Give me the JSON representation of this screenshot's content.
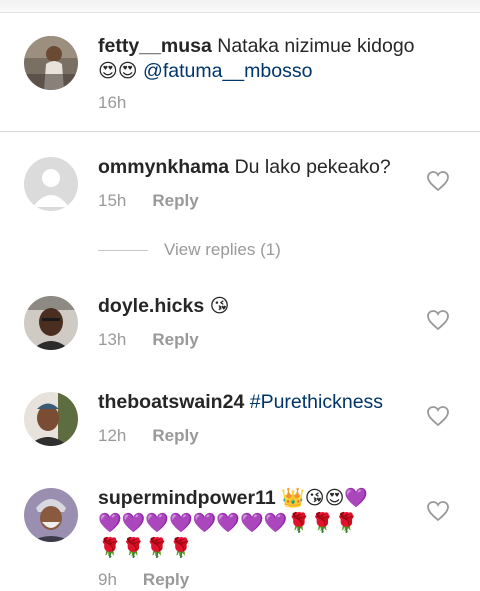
{
  "caption": {
    "username": "fetty__musa",
    "text": "Nataka nizimue kidogo",
    "emojis": "😍😍",
    "mention": "@fatuma__mbosso",
    "time": "16h"
  },
  "comments": [
    {
      "username": "ommynkhama",
      "text": "Du lako pekeako?",
      "time": "15h",
      "reply_label": "Reply"
    },
    {
      "username": "doyle.hicks",
      "text": "😘",
      "time": "13h",
      "reply_label": "Reply"
    },
    {
      "username": "theboatswain24",
      "hashtag": "#Purethickness",
      "time": "12h",
      "reply_label": "Reply"
    },
    {
      "username": "supermindpower11",
      "line1": "👑😘😍💜",
      "line2": "💜💜💜💜💜💜💜💜🌹🌹🌹",
      "line3": "🌹🌹🌹🌹",
      "time": "9h",
      "reply_label": "Reply"
    }
  ],
  "view_replies": "View replies (1)",
  "colors": {
    "link": "#003569",
    "meta": "#999999",
    "text": "#262626"
  }
}
